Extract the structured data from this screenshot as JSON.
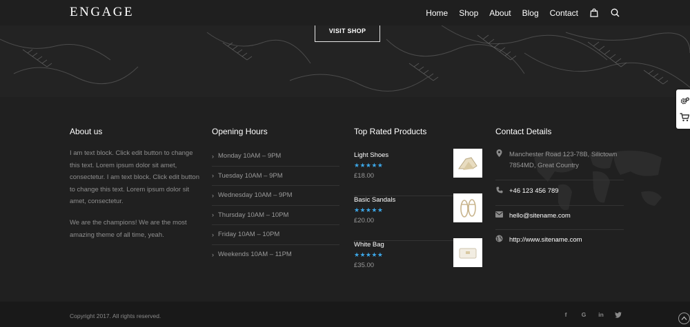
{
  "header": {
    "logo": "ENGAGE",
    "nav": [
      "Home",
      "Shop",
      "About",
      "Blog",
      "Contact"
    ],
    "cart_icon": "shopping-bag-icon",
    "search_icon": "search-icon"
  },
  "hero": {
    "button_label": "VISIT SHOP"
  },
  "footer": {
    "about": {
      "title": "About us",
      "paragraph1": "I am text block. Click edit button to change this text. Lorem ipsum dolor sit amet, consectetur. I am text block. Click edit button to change this text. Lorem ipsum dolor sit amet, consectetur.",
      "paragraph2": "We are the champions! We are the most amazing theme of all time, yeah."
    },
    "hours": {
      "title": "Opening Hours",
      "items": [
        "Monday 10AM – 9PM",
        "Tuesday 10AM – 9PM",
        "Wednesday 10AM – 9PM",
        "Thursday 10AM – 10PM",
        "Friday 10AM – 10PM",
        "Weekends 10AM – 11PM"
      ]
    },
    "products": {
      "title": "Top Rated Products",
      "items": [
        {
          "name": "Light Shoes",
          "rating": "★★★★★",
          "price": "£18.00"
        },
        {
          "name": "Basic Sandals",
          "rating": "★★★★★",
          "price": "£20.00"
        },
        {
          "name": "White Bag",
          "rating": "★★★★★",
          "price": "£35.00"
        }
      ],
      "star_color": "#3ca7e8"
    },
    "contact": {
      "title": "Contact Details",
      "address": "Manchester Road 123-78B, Silictown 7854MD, Great Country",
      "phone": "+46 123 456 789",
      "email": "hello@sitename.com",
      "website": "http://www.sitename.com"
    }
  },
  "bottom": {
    "copyright": "Copyright 2017. All rights reserved.",
    "social": [
      "f",
      "G",
      "in"
    ],
    "social_icons": [
      "facebook-icon",
      "google-icon",
      "linkedin-icon",
      "twitter-icon"
    ]
  }
}
